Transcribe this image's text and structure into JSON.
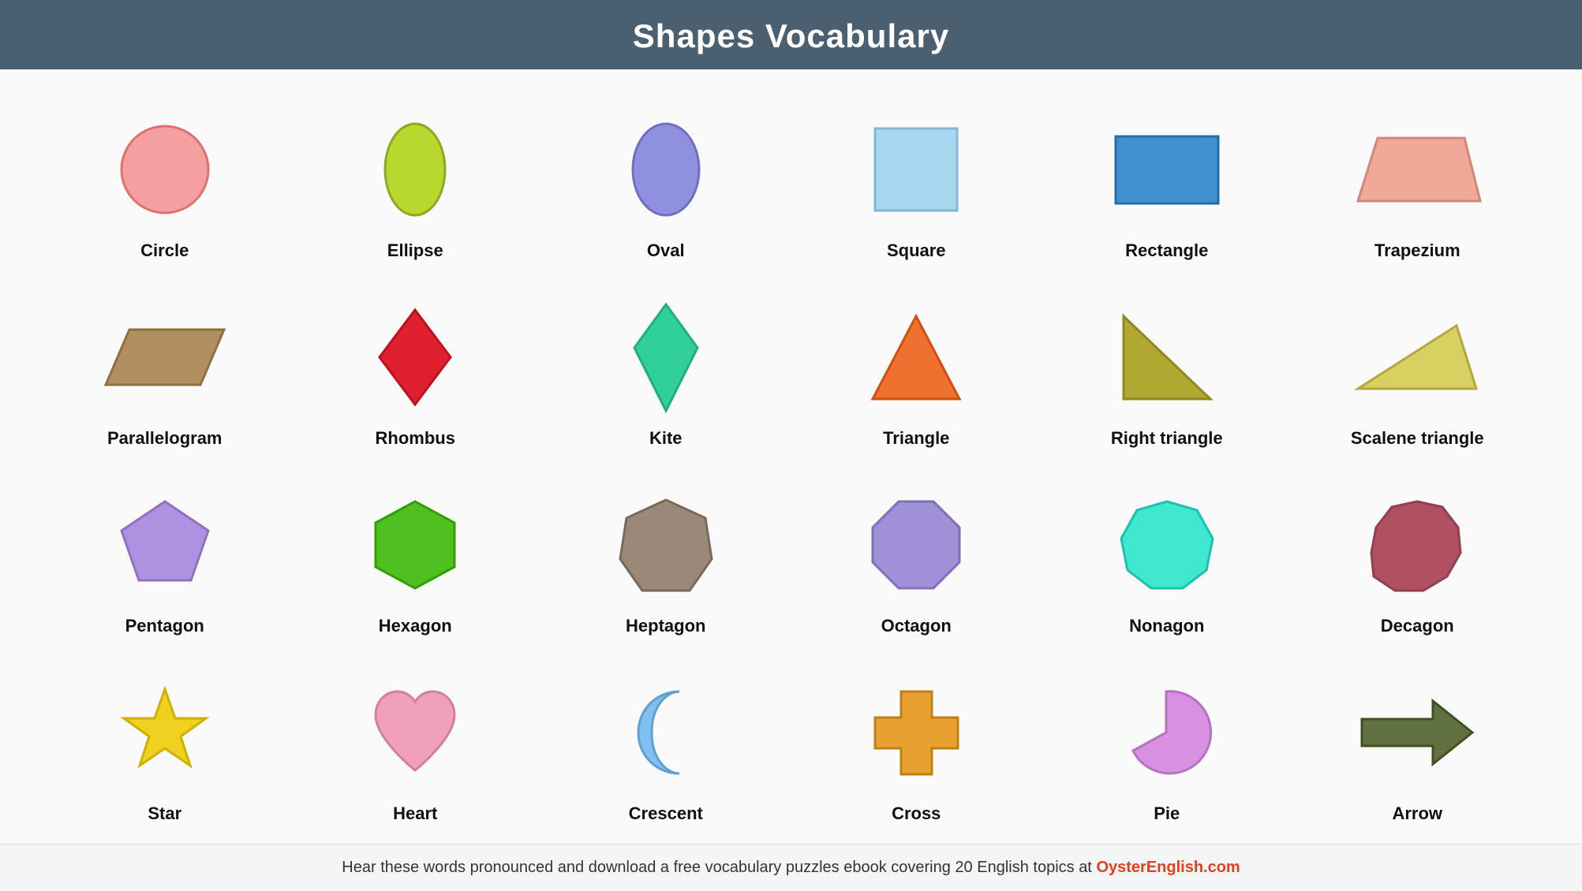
{
  "header": {
    "title": "Shapes Vocabulary"
  },
  "shapes": [
    {
      "id": "circle",
      "label": "Circle"
    },
    {
      "id": "ellipse",
      "label": "Ellipse"
    },
    {
      "id": "oval",
      "label": "Oval"
    },
    {
      "id": "square",
      "label": "Square"
    },
    {
      "id": "rectangle",
      "label": "Rectangle"
    },
    {
      "id": "trapezium",
      "label": "Trapezium"
    },
    {
      "id": "parallelogram",
      "label": "Parallelogram"
    },
    {
      "id": "rhombus",
      "label": "Rhombus"
    },
    {
      "id": "kite",
      "label": "Kite"
    },
    {
      "id": "triangle",
      "label": "Triangle"
    },
    {
      "id": "right-triangle",
      "label": "Right triangle"
    },
    {
      "id": "scalene-triangle",
      "label": "Scalene triangle"
    },
    {
      "id": "pentagon",
      "label": "Pentagon"
    },
    {
      "id": "hexagon",
      "label": "Hexagon"
    },
    {
      "id": "heptagon",
      "label": "Heptagon"
    },
    {
      "id": "octagon",
      "label": "Octagon"
    },
    {
      "id": "nonagon",
      "label": "Nonagon"
    },
    {
      "id": "decagon",
      "label": "Decagon"
    },
    {
      "id": "star",
      "label": "Star"
    },
    {
      "id": "heart",
      "label": "Heart"
    },
    {
      "id": "crescent",
      "label": "Crescent"
    },
    {
      "id": "cross",
      "label": "Cross"
    },
    {
      "id": "pie",
      "label": "Pie"
    },
    {
      "id": "arrow",
      "label": "Arrow"
    }
  ],
  "footer": {
    "text": "Hear these words pronounced and download a free vocabulary puzzles ebook covering 20 English topics at ",
    "brand": "OysterEnglish.com"
  }
}
